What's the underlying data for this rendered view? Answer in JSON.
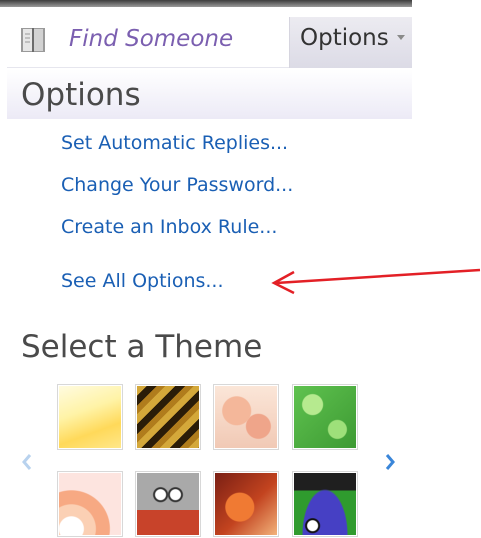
{
  "header": {
    "find_someone_label": "Find Someone",
    "options_tab_label": "Options"
  },
  "options_menu": {
    "heading": "Options",
    "items": [
      {
        "label": "Set Automatic Replies..."
      },
      {
        "label": "Change Your Password..."
      },
      {
        "label": "Create an Inbox Rule..."
      },
      {
        "label": "See All Options..."
      }
    ]
  },
  "themes": {
    "heading": "Select a Theme",
    "swatches": [
      {
        "icon": "sunny-theme-thumbnail",
        "colors": [
          "#fff9c9",
          "#ffe06a"
        ]
      },
      {
        "icon": "tiger-theme-thumbnail",
        "colors": [
          "#3b2a10",
          "#c9a032"
        ]
      },
      {
        "icon": "floral-theme-thumbnail",
        "colors": [
          "#f7dcc9",
          "#e9a98c"
        ]
      },
      {
        "icon": "leafy-theme-thumbnail",
        "colors": [
          "#7bd36a",
          "#3e9d35"
        ]
      },
      {
        "icon": "sunburst-theme-thumbnail",
        "colors": [
          "#fde7e4",
          "#f6a27a"
        ]
      },
      {
        "icon": "robot-theme-thumbnail",
        "colors": [
          "#c9c9c9",
          "#d24a2a"
        ]
      },
      {
        "icon": "autumn-theme-thumbnail",
        "colors": [
          "#8a2a1b",
          "#e3722c"
        ]
      },
      {
        "icon": "monster-theme-thumbnail",
        "colors": [
          "#2e9a2c",
          "#4b46c8"
        ]
      }
    ]
  },
  "colors": {
    "link": "#1a5fb4",
    "annotation_arrow": "#e32026",
    "find_label": "#7b5fb0"
  }
}
